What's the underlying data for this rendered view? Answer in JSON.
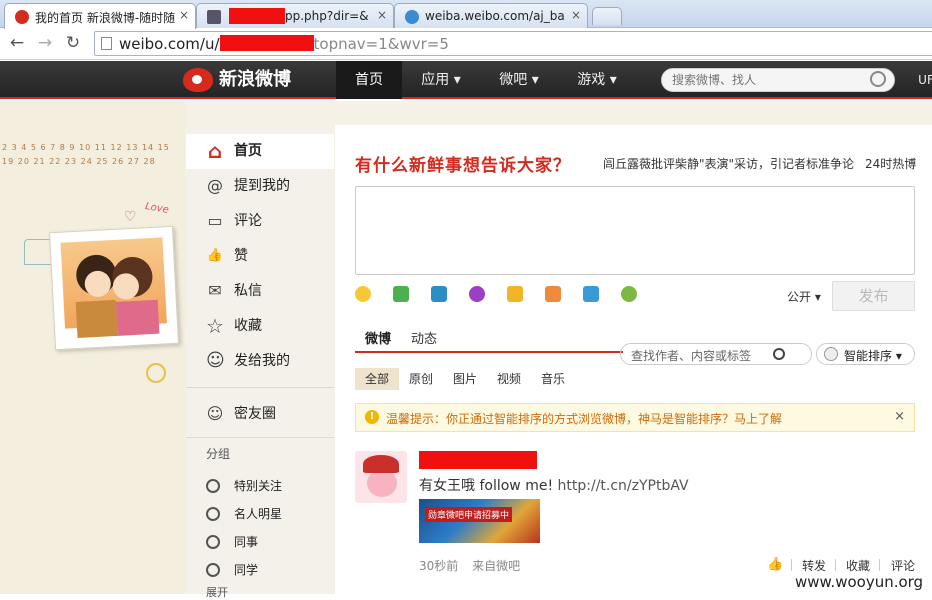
{
  "browser": {
    "tabs": [
      {
        "title": "我的首页 新浪微博-随时随",
        "close": "×"
      },
      {
        "title": "pp.php?dir=&",
        "close": "×"
      },
      {
        "title": "weiba.weibo.com/aj_ba",
        "close": "×"
      }
    ],
    "url_host": "weibo.com/u/",
    "url_rest": "topnav=1&wvr=5"
  },
  "topnav": {
    "logo": "新浪微博",
    "items": [
      "首页",
      "应用 ▾",
      "微吧 ▾",
      "游戏 ▾"
    ],
    "search_placeholder": "搜索微博、找人",
    "right_clip": "UF"
  },
  "calendar": {
    "row1": "2 3 4 5 6 7 8 9 10 11 12 13 14 15",
    "row2": "19 20 21 22 23 24 25 26 27 28"
  },
  "deco": {
    "love": "Love"
  },
  "sidebar": {
    "main_items": [
      {
        "label": "首页",
        "icon": "home-icon",
        "glyph": "⌂"
      },
      {
        "label": "提到我的",
        "icon": "at-icon",
        "glyph": "@"
      },
      {
        "label": "评论",
        "icon": "comment-icon",
        "glyph": "▭"
      },
      {
        "label": "赞",
        "icon": "thumb-icon",
        "glyph": "👍"
      },
      {
        "label": "私信",
        "icon": "mail-icon",
        "glyph": "✉"
      },
      {
        "label": "收藏",
        "icon": "star-icon",
        "glyph": "☆"
      },
      {
        "label": "发给我的",
        "icon": "person-icon",
        "glyph": "☺"
      }
    ],
    "friends_circle": "密友圈",
    "group_title": "分组",
    "groups": [
      "特别关注",
      "名人明星",
      "同事",
      "同学"
    ],
    "expand": "展开"
  },
  "compose": {
    "headline": "有什么新鲜事想告诉大家？",
    "hot_topic": "闾丘露薇批评柴静\"表演\"采访，引记者标准争论",
    "hot_label": "24时热博",
    "visibility": "公开 ▾",
    "publish": "发布"
  },
  "feed": {
    "tabs": [
      "微博",
      "动态"
    ],
    "filter_placeholder": "查找作者、内容或标签",
    "sort": "智能排序 ▾",
    "subtabs": [
      "全部",
      "原创",
      "图片",
      "视频",
      "音乐"
    ],
    "notice": "温馨提示：你正通过智能排序的方式浏览微博，神马是智能排序？马上了解",
    "post": {
      "text": "有女王哦 follow me! ",
      "link": "http://t.cn/zYPtbAV",
      "image_caption": "勋章微吧申请招募中",
      "time": "30秒前",
      "source": "来自微吧",
      "actions": [
        "转发",
        "收藏",
        "评论"
      ]
    }
  },
  "watermark": "www.wooyun.org"
}
